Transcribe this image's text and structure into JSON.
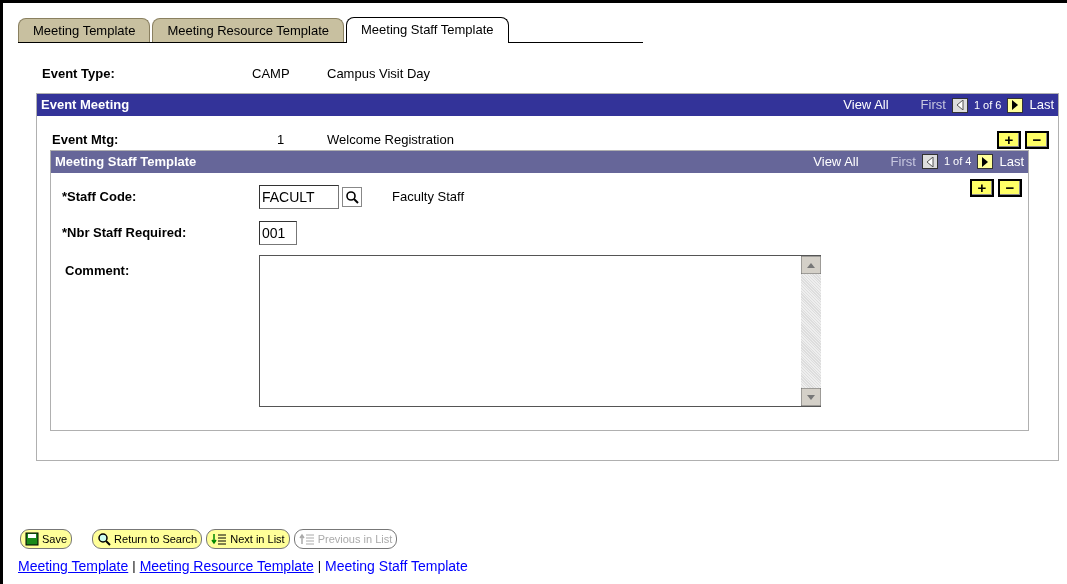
{
  "tabs": [
    {
      "label": "Meeting Template",
      "selected": false
    },
    {
      "label": "Meeting Resource Template",
      "selected": false
    },
    {
      "label": "Meeting Staff Template",
      "selected": true
    }
  ],
  "event_type": {
    "label": "Event Type:",
    "code": "CAMP",
    "description": "Campus Visit Day"
  },
  "event_meeting": {
    "title": "Event Meeting",
    "view_all": "View All",
    "first": "First",
    "count": "1 of 6",
    "last": "Last",
    "label": "Event Mtg:",
    "number": "1",
    "description": "Welcome Registration",
    "add": "+",
    "remove": "−",
    "staff_template": {
      "title": "Meeting Staff Template",
      "view_all": "View All",
      "first": "First",
      "count": "1 of 4",
      "last": "Last",
      "add": "+",
      "remove": "−",
      "staff_code": {
        "label": "*Staff Code:",
        "value": "FACULT",
        "description": "Faculty Staff"
      },
      "nbr_staff": {
        "label": "*Nbr Staff Required:",
        "value": "001"
      },
      "comment": {
        "label": "Comment:"
      }
    }
  },
  "toolbar": [
    {
      "kind": "save",
      "label": "Save",
      "disabled": false
    },
    {
      "kind": "search",
      "label": "Return to Search",
      "disabled": false
    },
    {
      "kind": "next",
      "label": "Next in List",
      "disabled": false
    },
    {
      "kind": "previous",
      "label": "Previous in List",
      "disabled": true
    }
  ],
  "footer_links": [
    {
      "label": "Meeting Template",
      "selected": false
    },
    {
      "label": "Meeting Resource Template",
      "selected": false
    },
    {
      "label": "Meeting Staff Template",
      "selected": true
    }
  ],
  "footer_separator": [
    "|",
    "|"
  ]
}
